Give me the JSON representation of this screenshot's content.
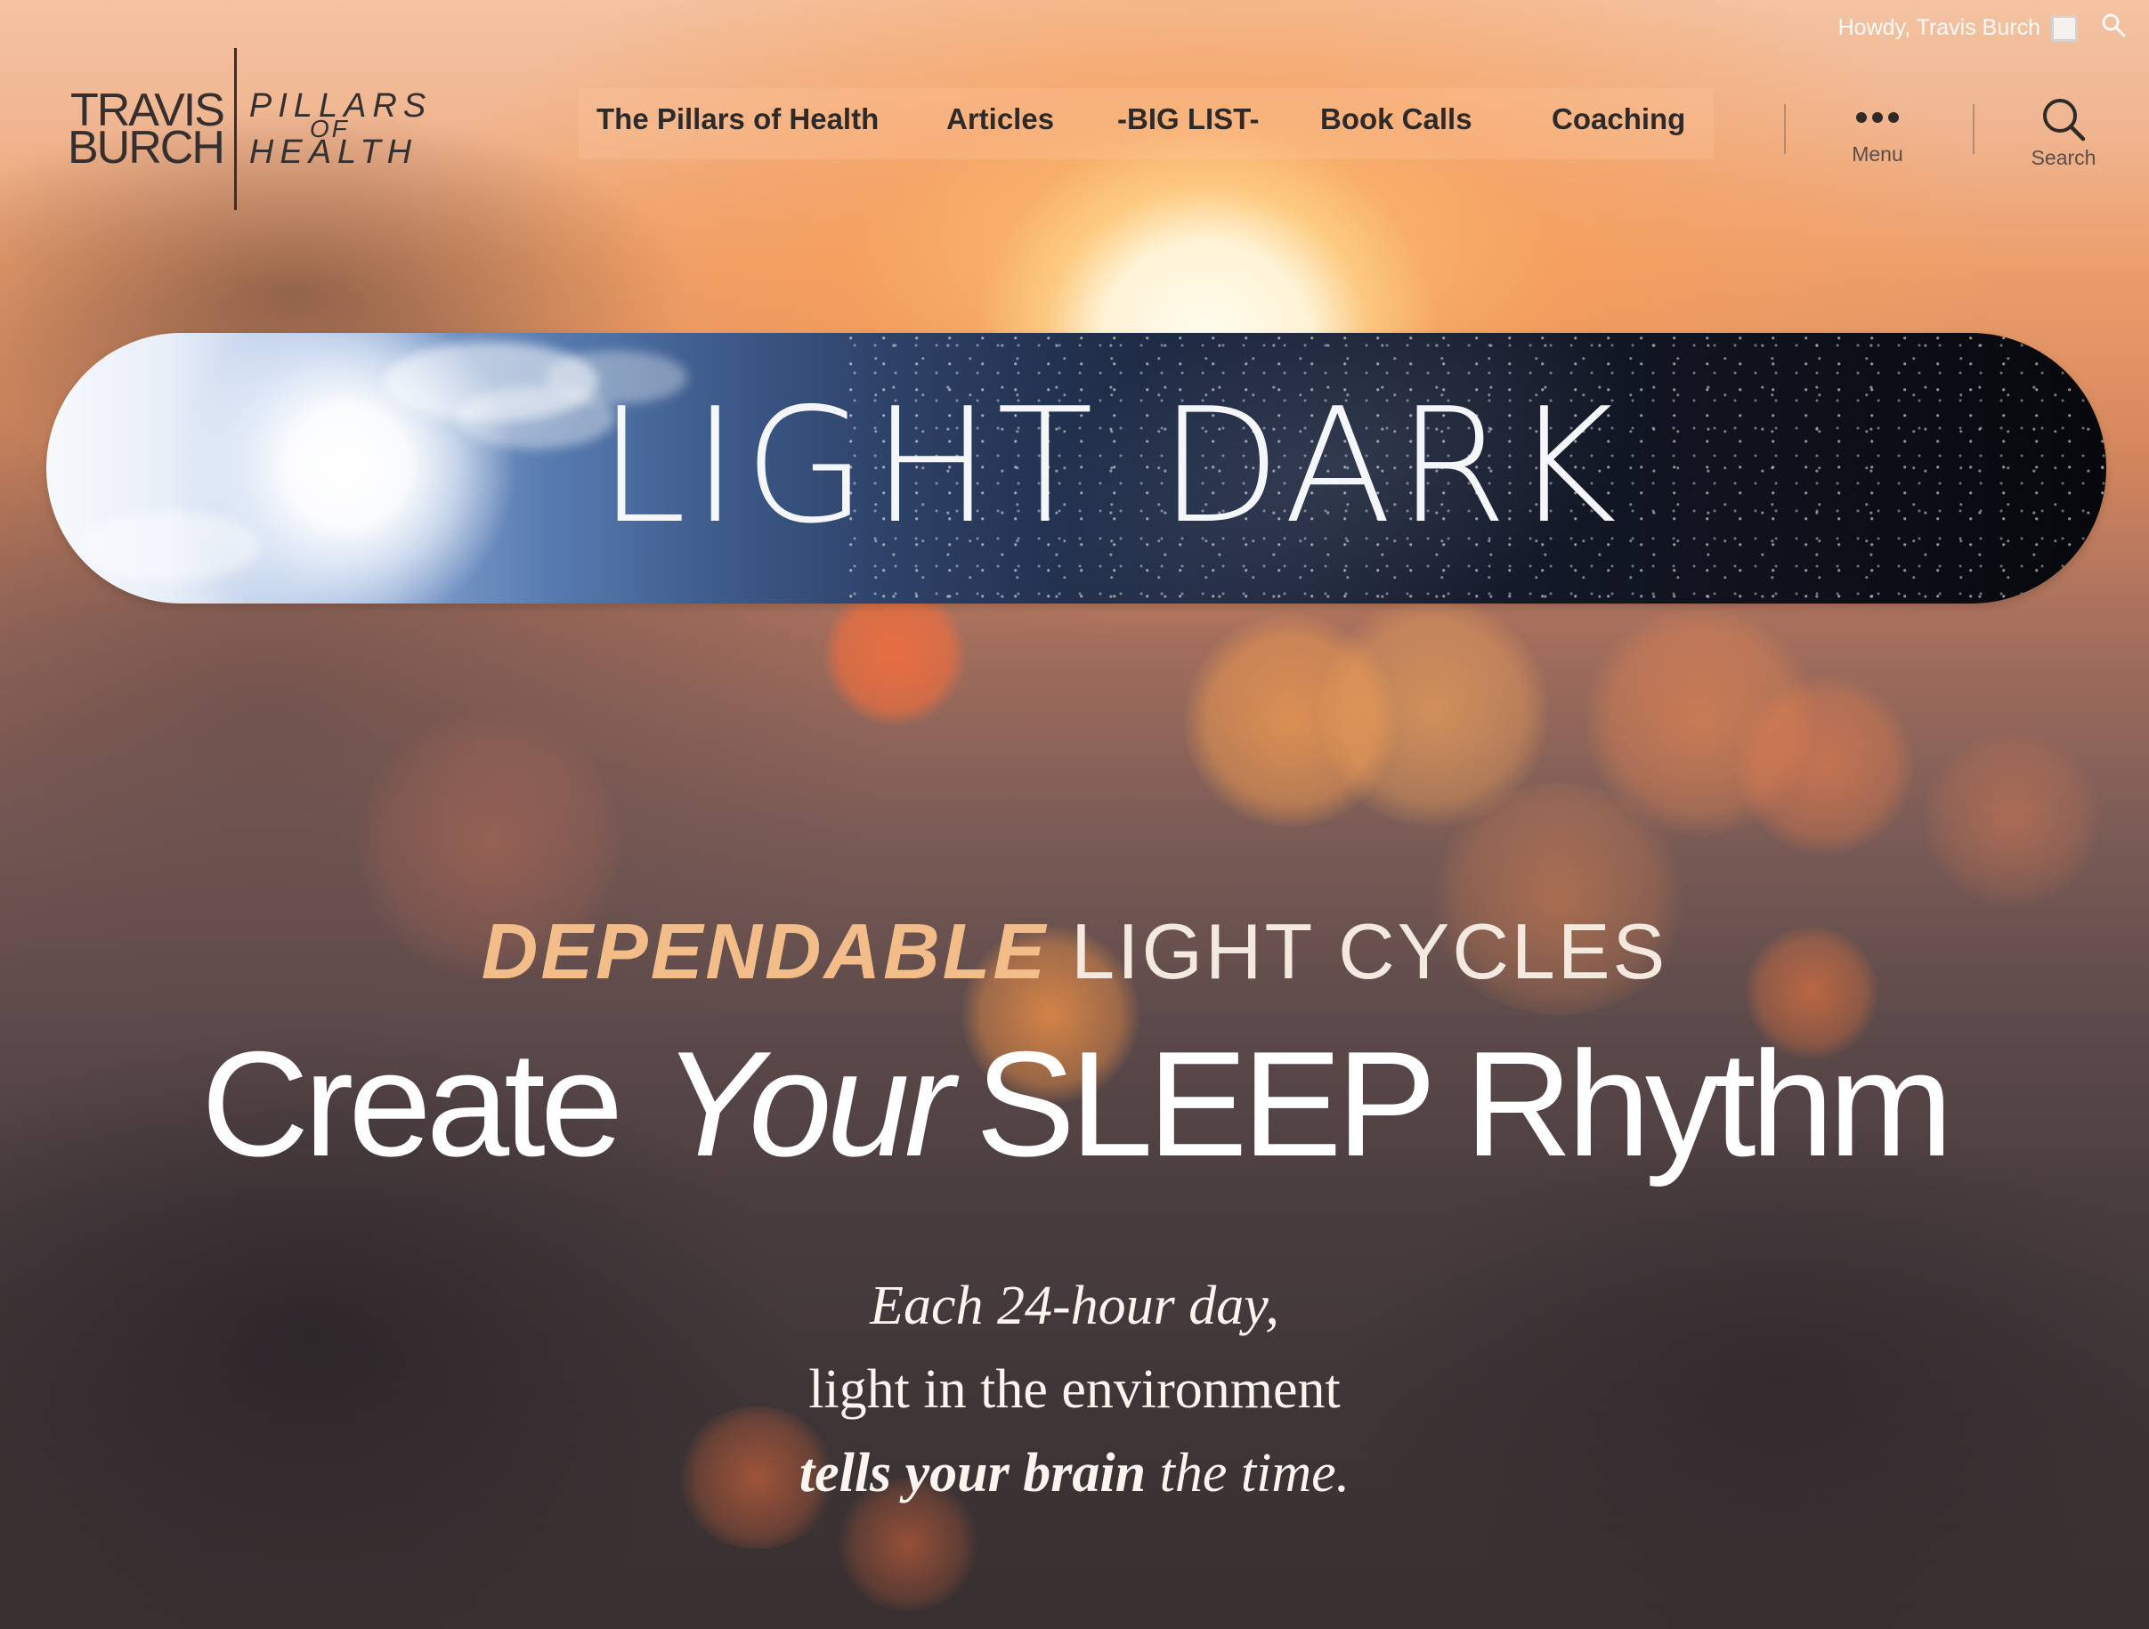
{
  "admin_bar": {
    "greeting": "Howdy, Travis Burch",
    "avatar_icon": "user-avatar-icon",
    "search_icon": "magnifier-icon"
  },
  "logo": {
    "line1": "TRAVIS",
    "line2": "BURCH",
    "right_line1": "PILLARS",
    "right_line2": "OF",
    "right_line3": "HEALTH"
  },
  "nav": {
    "items": [
      {
        "label": "The Pillars of Health"
      },
      {
        "label": "Articles"
      },
      {
        "label": "-BIG LIST-"
      },
      {
        "label": "Book Calls"
      },
      {
        "label": "Coaching"
      }
    ]
  },
  "tools": {
    "menu_label": "Menu",
    "search_label": "Search"
  },
  "banner": {
    "word_light": "LIGHT",
    "word_dark": "DARK"
  },
  "hero": {
    "kicker_emphasis": "DEPENDABLE",
    "kicker_rest": "LIGHT CYCLES",
    "headline_part1": "Create",
    "headline_italic": "Your",
    "headline_part2": "SLEEP Rhythm",
    "tagline_line1": "Each 24-hour day,",
    "tagline_line2": "light in the environment",
    "tagline_line3_emph": "tells your brain",
    "tagline_line3_rest": "the time."
  },
  "colors": {
    "kicker_accent": "#f3bd8a",
    "nav_text": "#2e2a2a",
    "headline": "#ffffff"
  }
}
